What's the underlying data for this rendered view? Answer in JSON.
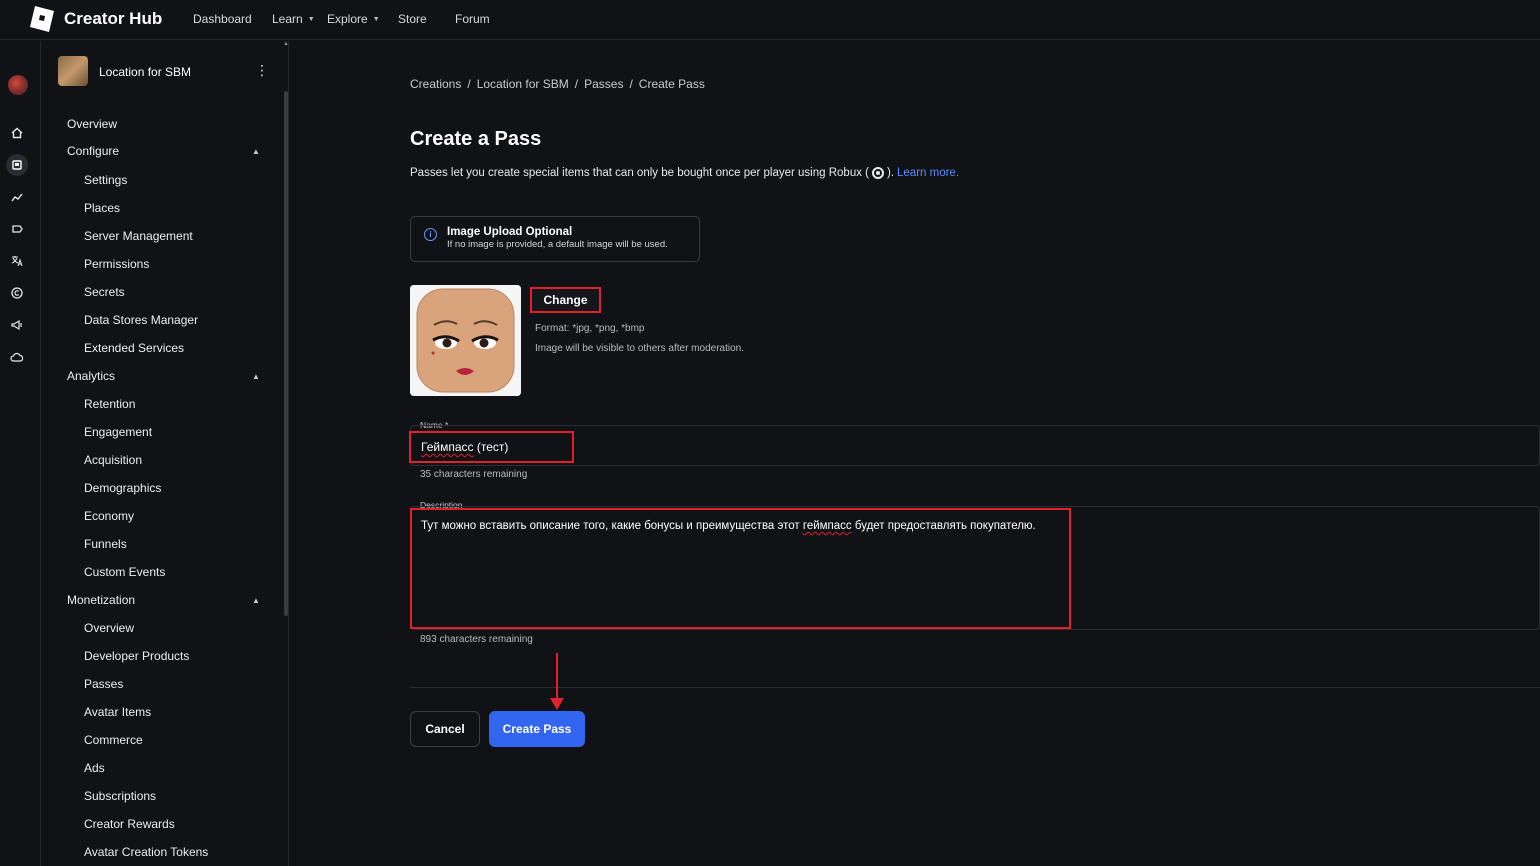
{
  "topbar": {
    "brand": "Creator Hub",
    "nav": [
      "Dashboard",
      "Learn",
      "Explore",
      "Store",
      "Forum"
    ]
  },
  "experience": {
    "title": "Location for SBM"
  },
  "sidebar": {
    "overview": "Overview",
    "configure": {
      "label": "Configure",
      "items": [
        "Settings",
        "Places",
        "Server Management",
        "Permissions",
        "Secrets",
        "Data Stores Manager",
        "Extended Services"
      ]
    },
    "analytics": {
      "label": "Analytics",
      "items": [
        "Retention",
        "Engagement",
        "Acquisition",
        "Demographics",
        "Economy",
        "Funnels",
        "Custom Events"
      ]
    },
    "monetization": {
      "label": "Monetization",
      "items": [
        "Overview",
        "Developer Products",
        "Passes",
        "Avatar Items",
        "Commerce",
        "Ads",
        "Subscriptions",
        "Creator Rewards",
        "Avatar Creation Tokens"
      ]
    }
  },
  "breadcrumb": [
    "Creations",
    "/",
    "Location for SBM",
    "/",
    "Passes",
    "/",
    "Create Pass"
  ],
  "page": {
    "title": "Create a Pass",
    "intro": "Passes let you create special items that can only be bought once per player using Robux (",
    "intro_end": ").",
    "learn_more": "Learn more."
  },
  "info": {
    "title": "Image Upload Optional",
    "subtitle": "If no image is provided, a default image will be used."
  },
  "image": {
    "change_label": "Change",
    "format_hint": "Format: *jpg, *png, *bmp",
    "moderation_hint": "Image will be visible to others after moderation."
  },
  "name_field": {
    "label": "Name *",
    "value_word": "Геймпасс",
    "value_rest": " (тест)",
    "remaining": "35 characters remaining"
  },
  "description_field": {
    "label": "Description",
    "value_before": "Тут можно вставить описание того, какие бонусы и преимущества этот ",
    "value_word": "геймпасс",
    "value_after": " будет предоставлять покупателю.",
    "remaining": "893 characters remaining"
  },
  "actions": {
    "cancel": "Cancel",
    "create": "Create Pass"
  },
  "colors": {
    "accent": "#3366f0",
    "highlight": "#e0202a",
    "link": "#5b8cff",
    "background": "#111216"
  }
}
